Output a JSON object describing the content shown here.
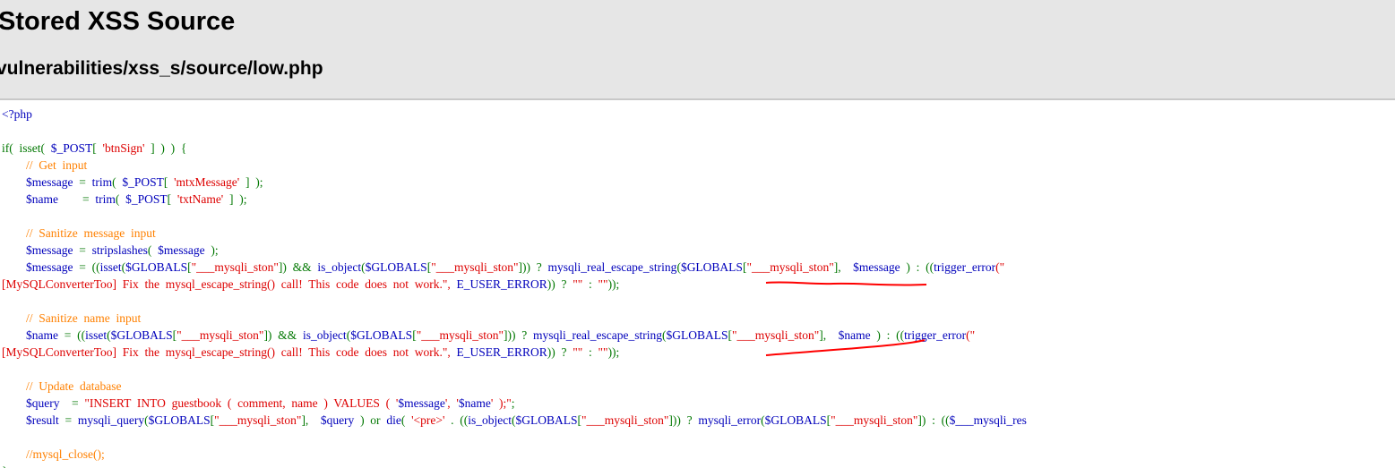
{
  "header": {
    "title": "Stored XSS Source",
    "path": "vulnerabilities/xss_s/source/low.php"
  },
  "code": {
    "lines": [
      [
        {
          "t": "<?php",
          "c": "var"
        }
      ],
      [],
      [
        {
          "t": "if(  isset(  ",
          "c": "kw"
        },
        {
          "t": "$_POST",
          "c": "var"
        },
        {
          "t": "[  ",
          "c": "kw"
        },
        {
          "t": "'btnSign'",
          "c": "str"
        },
        {
          "t": "  ]  )  )  {",
          "c": "kw"
        }
      ],
      [
        {
          "t": "        ",
          "c": "kw"
        },
        {
          "t": "//  Get  input",
          "c": "cmt"
        }
      ],
      [
        {
          "t": "        ",
          "c": "kw"
        },
        {
          "t": "$message  ",
          "c": "var"
        },
        {
          "t": "=  ",
          "c": "kw"
        },
        {
          "t": "trim",
          "c": "var"
        },
        {
          "t": "(  ",
          "c": "kw"
        },
        {
          "t": "$_POST",
          "c": "var"
        },
        {
          "t": "[  ",
          "c": "kw"
        },
        {
          "t": "'mtxMessage'",
          "c": "str"
        },
        {
          "t": "  ]  );",
          "c": "kw"
        }
      ],
      [
        {
          "t": "        ",
          "c": "kw"
        },
        {
          "t": "$name        ",
          "c": "var"
        },
        {
          "t": "=  ",
          "c": "kw"
        },
        {
          "t": "trim",
          "c": "var"
        },
        {
          "t": "(  ",
          "c": "kw"
        },
        {
          "t": "$_POST",
          "c": "var"
        },
        {
          "t": "[  ",
          "c": "kw"
        },
        {
          "t": "'txtName'",
          "c": "str"
        },
        {
          "t": "  ]  );",
          "c": "kw"
        }
      ],
      [],
      [
        {
          "t": "        ",
          "c": "kw"
        },
        {
          "t": "//  Sanitize  message  input",
          "c": "cmt"
        }
      ],
      [
        {
          "t": "        ",
          "c": "kw"
        },
        {
          "t": "$message  ",
          "c": "var"
        },
        {
          "t": "=  ",
          "c": "kw"
        },
        {
          "t": "stripslashes",
          "c": "var"
        },
        {
          "t": "(  ",
          "c": "kw"
        },
        {
          "t": "$message  ",
          "c": "var"
        },
        {
          "t": ");",
          "c": "kw"
        }
      ],
      [
        {
          "t": "        ",
          "c": "kw"
        },
        {
          "t": "$message  ",
          "c": "var"
        },
        {
          "t": "=  ((",
          "c": "kw"
        },
        {
          "t": "isset",
          "c": "var"
        },
        {
          "t": "(",
          "c": "kw"
        },
        {
          "t": "$GLOBALS",
          "c": "var"
        },
        {
          "t": "[",
          "c": "kw"
        },
        {
          "t": "\"___mysqli_ston\"",
          "c": "str"
        },
        {
          "t": "])  &&  ",
          "c": "kw"
        },
        {
          "t": "is_object",
          "c": "var"
        },
        {
          "t": "(",
          "c": "kw"
        },
        {
          "t": "$GLOBALS",
          "c": "var"
        },
        {
          "t": "[",
          "c": "kw"
        },
        {
          "t": "\"___mysqli_ston\"",
          "c": "str"
        },
        {
          "t": "]))  ?  ",
          "c": "kw"
        },
        {
          "t": "mysqli_real_escape_string",
          "c": "var"
        },
        {
          "t": "(",
          "c": "kw"
        },
        {
          "t": "$GLOBALS",
          "c": "var"
        },
        {
          "t": "[",
          "c": "kw"
        },
        {
          "t": "\"___mysqli_ston\"",
          "c": "str"
        },
        {
          "t": "],    ",
          "c": "kw"
        },
        {
          "t": "$message  ",
          "c": "var"
        },
        {
          "t": ")  :  ((",
          "c": "kw"
        },
        {
          "t": "trigger_error",
          "c": "var"
        },
        {
          "t": "(\"",
          "c": "str"
        }
      ],
      [
        {
          "t": "[MySQLConverterToo]  Fix  the  mysql_escape_string()  call!  This  code  does  not  work.\",",
          "c": "str"
        },
        {
          "t": "  ",
          "c": "kw"
        },
        {
          "t": "E_USER_ERROR",
          "c": "var"
        },
        {
          "t": "))  ?  ",
          "c": "kw"
        },
        {
          "t": "\"\"",
          "c": "str"
        },
        {
          "t": "  :  ",
          "c": "kw"
        },
        {
          "t": "\"\"",
          "c": "str"
        },
        {
          "t": "));",
          "c": "kw"
        }
      ],
      [],
      [
        {
          "t": "        ",
          "c": "kw"
        },
        {
          "t": "//  Sanitize  name  input",
          "c": "cmt"
        }
      ],
      [
        {
          "t": "        ",
          "c": "kw"
        },
        {
          "t": "$name  ",
          "c": "var"
        },
        {
          "t": "=  ((",
          "c": "kw"
        },
        {
          "t": "isset",
          "c": "var"
        },
        {
          "t": "(",
          "c": "kw"
        },
        {
          "t": "$GLOBALS",
          "c": "var"
        },
        {
          "t": "[",
          "c": "kw"
        },
        {
          "t": "\"___mysqli_ston\"",
          "c": "str"
        },
        {
          "t": "])  &&  ",
          "c": "kw"
        },
        {
          "t": "is_object",
          "c": "var"
        },
        {
          "t": "(",
          "c": "kw"
        },
        {
          "t": "$GLOBALS",
          "c": "var"
        },
        {
          "t": "[",
          "c": "kw"
        },
        {
          "t": "\"___mysqli_ston\"",
          "c": "str"
        },
        {
          "t": "]))  ?  ",
          "c": "kw"
        },
        {
          "t": "mysqli_real_escape_string",
          "c": "var"
        },
        {
          "t": "(",
          "c": "kw"
        },
        {
          "t": "$GLOBALS",
          "c": "var"
        },
        {
          "t": "[",
          "c": "kw"
        },
        {
          "t": "\"___mysqli_ston\"",
          "c": "str"
        },
        {
          "t": "],    ",
          "c": "kw"
        },
        {
          "t": "$name  ",
          "c": "var"
        },
        {
          "t": ")  :  ((",
          "c": "kw"
        },
        {
          "t": "trigger_error",
          "c": "var"
        },
        {
          "t": "(\"",
          "c": "str"
        }
      ],
      [
        {
          "t": "[MySQLConverterToo]  Fix  the  mysql_escape_string()  call!  This  code  does  not  work.\",",
          "c": "str"
        },
        {
          "t": "  ",
          "c": "kw"
        },
        {
          "t": "E_USER_ERROR",
          "c": "var"
        },
        {
          "t": "))  ?  ",
          "c": "kw"
        },
        {
          "t": "\"\"",
          "c": "str"
        },
        {
          "t": "  :  ",
          "c": "kw"
        },
        {
          "t": "\"\"",
          "c": "str"
        },
        {
          "t": "));",
          "c": "kw"
        }
      ],
      [],
      [
        {
          "t": "        ",
          "c": "kw"
        },
        {
          "t": "//  Update  database",
          "c": "cmt"
        }
      ],
      [
        {
          "t": "        ",
          "c": "kw"
        },
        {
          "t": "$query    ",
          "c": "var"
        },
        {
          "t": "=  ",
          "c": "kw"
        },
        {
          "t": "\"INSERT  INTO  guestbook  (  comment,  name  )  VALUES  (  '",
          "c": "str"
        },
        {
          "t": "$message",
          "c": "var"
        },
        {
          "t": "',  '",
          "c": "str"
        },
        {
          "t": "$name",
          "c": "var"
        },
        {
          "t": "'  );\"",
          "c": "str"
        },
        {
          "t": ";",
          "c": "kw"
        }
      ],
      [
        {
          "t": "        ",
          "c": "kw"
        },
        {
          "t": "$result  ",
          "c": "var"
        },
        {
          "t": "=  ",
          "c": "kw"
        },
        {
          "t": "mysqli_query",
          "c": "var"
        },
        {
          "t": "(",
          "c": "kw"
        },
        {
          "t": "$GLOBALS",
          "c": "var"
        },
        {
          "t": "[",
          "c": "kw"
        },
        {
          "t": "\"___mysqli_ston\"",
          "c": "str"
        },
        {
          "t": "],    ",
          "c": "kw"
        },
        {
          "t": "$query  ",
          "c": "var"
        },
        {
          "t": ")  or  ",
          "c": "kw"
        },
        {
          "t": "die",
          "c": "var"
        },
        {
          "t": "(  ",
          "c": "kw"
        },
        {
          "t": "'<pre>'",
          "c": "str"
        },
        {
          "t": "  .  ((",
          "c": "kw"
        },
        {
          "t": "is_object",
          "c": "var"
        },
        {
          "t": "(",
          "c": "kw"
        },
        {
          "t": "$GLOBALS",
          "c": "var"
        },
        {
          "t": "[",
          "c": "kw"
        },
        {
          "t": "\"___mysqli_ston\"",
          "c": "str"
        },
        {
          "t": "]))  ?  ",
          "c": "kw"
        },
        {
          "t": "mysqli_error",
          "c": "var"
        },
        {
          "t": "(",
          "c": "kw"
        },
        {
          "t": "$GLOBALS",
          "c": "var"
        },
        {
          "t": "[",
          "c": "kw"
        },
        {
          "t": "\"___mysqli_ston\"",
          "c": "str"
        },
        {
          "t": "])  :  ((",
          "c": "kw"
        },
        {
          "t": "$___mysqli_res",
          "c": "var"
        }
      ],
      [],
      [
        {
          "t": "        ",
          "c": "kw"
        },
        {
          "t": "//mysql_close();",
          "c": "cmt"
        }
      ],
      [
        {
          "t": "}",
          "c": "kw"
        }
      ]
    ]
  },
  "colors": {
    "keyword": "#007700",
    "string": "#dd0000",
    "comment": "#ff8000",
    "default": "#0000bb",
    "annotation": "#ff0000"
  }
}
